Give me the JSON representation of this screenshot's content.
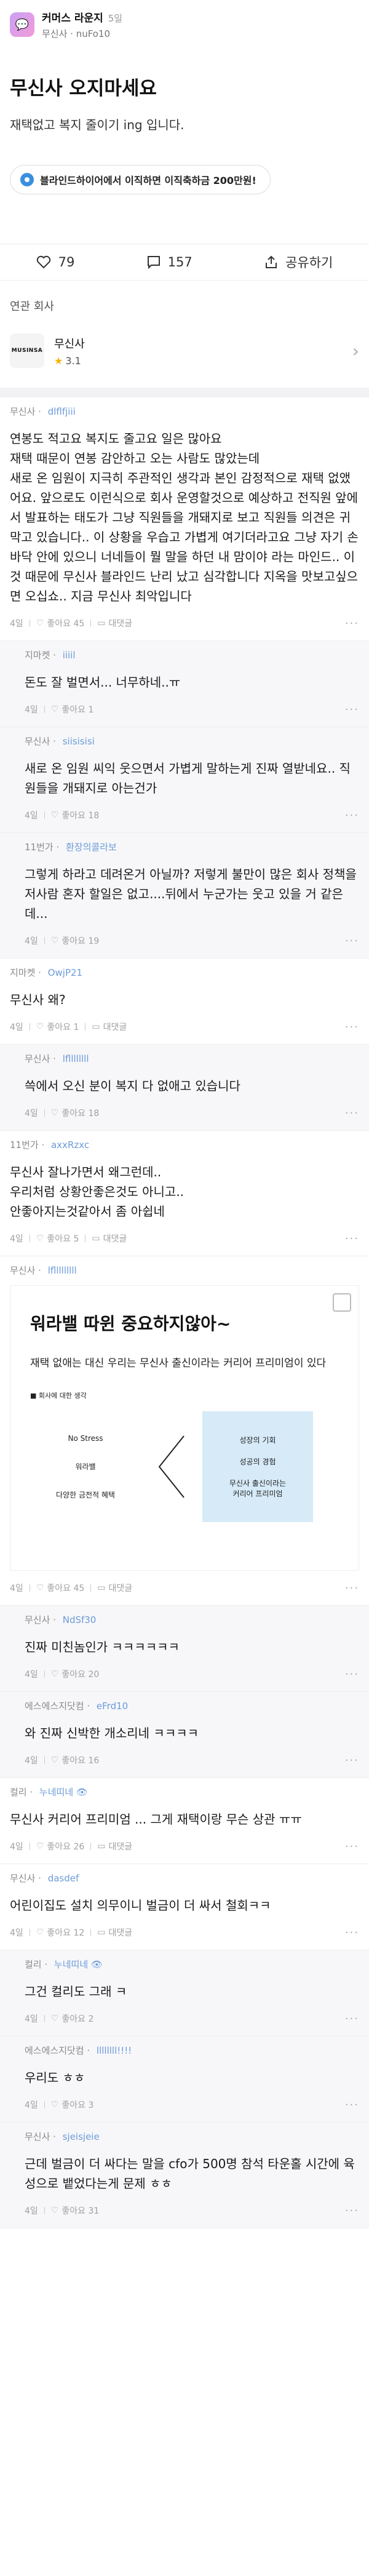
{
  "header": {
    "lounge_name": "커머스 라운지",
    "posted_ago": "5일",
    "author": "무신사 · nuFo10"
  },
  "post": {
    "title": "무신사 오지마세요",
    "body": "재택없고 복지 줄이기 ing 입니다."
  },
  "promo": {
    "label": "블라인드하이어에서 이직하면 이직축하금 200만원!"
  },
  "actions": {
    "likes": "79",
    "comments": "157",
    "share": "공유하기"
  },
  "related": {
    "section_title": "연관 회사",
    "company_name": "무신사",
    "rating": "3.1",
    "logo_text": "MUSINSA"
  },
  "labels": {
    "like": "좋아요",
    "reply": "대댓글"
  },
  "comments": [
    {
      "company": "무신사",
      "nick": "dlflfjiii",
      "text": "연봉도 적고요 복지도 줄고요 일은 많아요\n재택 때문이 연봉 감안하고 오는 사람도 많았는데\n새로 온 임원이 지극히 주관적인 생각과 본인 감정적으로 재택 없앴어요. 앞으로도 이런식으로 회사 운영할것으로 예상하고 전직원 앞에서 발표하는 태도가 그냥 직원들을 개돼지로 보고 직원들 의견은 귀막고 있습니다.. 이 상황을 우습고 가볍게 여기더라고요 그냥 자기 손바닥 안에 있으니 너네들이 뭘 말을 하던 내 맘이야 라는 마인드.. 이것 때문에 무신사 블라인드 난리 났고 심각합니다 지옥을 맛보고싶으면 오십쇼.. 지금 무신사 최악입니다",
      "date": "4일",
      "likes": "좋아요 45",
      "reply": true,
      "is_reply": false
    },
    {
      "company": "지마켓",
      "nick": "iiiil",
      "text": "돈도 잘 벌면서... 너무하네..ㅠ",
      "date": "4일",
      "likes": "좋아요 1",
      "reply": false,
      "is_reply": true
    },
    {
      "company": "무신사",
      "nick": "siisisisi",
      "text": "새로 온 임원 씨익 웃으면서 가볍게 말하는게 진짜 열받네요.. 직원들을 개돼지로 아는건가",
      "date": "4일",
      "likes": "좋아요 18",
      "reply": false,
      "is_reply": true
    },
    {
      "company": "11번가",
      "nick": "환장의콜라보",
      "text": "그렇게 하라고 데려온거 아닐까? 저렇게 불만이 많은 회사 정책을 저사람 혼자 할일은 없고....뒤에서 누군가는 웃고 있을 거 같은데...",
      "date": "4일",
      "likes": "좋아요 19",
      "reply": false,
      "is_reply": true
    },
    {
      "company": "지마켓",
      "nick": "OwjP21",
      "text": "무신사 왜?",
      "date": "4일",
      "likes": "좋아요 1",
      "reply": true,
      "is_reply": false
    },
    {
      "company": "무신사",
      "nick": "lfllllllll",
      "text": "쓱에서 오신 분이 복지 다 없애고 있습니다",
      "date": "4일",
      "likes": "좋아요 18",
      "reply": false,
      "is_reply": true
    },
    {
      "company": "11번가",
      "nick": "axxRzxc",
      "text": "무신사 잘나가면서 왜그런데..\n우리처럼 상황안좋은것도 아니고..\n안좋아지는것같아서 좀 아쉽네",
      "date": "4일",
      "likes": "좋아요 5",
      "reply": true,
      "is_reply": false
    },
    {
      "company": "무신사",
      "nick": "lflllllllll",
      "text": "",
      "date": "4일",
      "likes": "좋아요 45",
      "reply": true,
      "is_reply": false,
      "image": {
        "heading": "워라밸 따윈 중요하지않아~",
        "sub": "재택 없애는 대신 우리는 무신사 출신이라는 커리어 프리미엄이 있다",
        "label": "■ 회사에 대한 생각",
        "left": [
          "No Stress",
          "워라밸",
          "다양한 금전적 혜택"
        ],
        "right": [
          "성장의 기회",
          "성공의 경험",
          "무신사 출신이라는\n커리어 프리미엄"
        ]
      }
    },
    {
      "company": "무신사",
      "nick": "NdSf30",
      "text": "진짜 미친놈인가 ㅋㅋㅋㅋㅋㅋ",
      "date": "4일",
      "likes": "좋아요 20",
      "reply": false,
      "is_reply": true
    },
    {
      "company": "에스에스지닷컴",
      "nick": "eFrd10",
      "text": "와 진짜 신박한 개소리네 ㅋㅋㅋㅋ",
      "date": "4일",
      "likes": "좋아요 16",
      "reply": false,
      "is_reply": true
    },
    {
      "company": "컬리",
      "nick": "누네띠네 👁",
      "text": "무신사 커리어 프리미엄 ... 그게 재택이랑 무슨 상관 ㅠㅠ",
      "date": "4일",
      "likes": "좋아요 26",
      "reply": true,
      "is_reply": false
    },
    {
      "company": "무신사",
      "nick": "dasdef",
      "text": "어린이집도 설치 의무이니 벌금이 더 싸서 철회ㅋㅋ",
      "date": "4일",
      "likes": "좋아요 12",
      "reply": true,
      "is_reply": false
    },
    {
      "company": "컬리",
      "nick": "누네띠네 👁",
      "text": "그건 컬리도 그래 ㅋ",
      "date": "4일",
      "likes": "좋아요 2",
      "reply": false,
      "is_reply": true
    },
    {
      "company": "에스에스지닷컴",
      "nick": "llllllll!!!!",
      "text": "우리도 ㅎㅎ",
      "date": "4일",
      "likes": "좋아요 3",
      "reply": false,
      "is_reply": true
    },
    {
      "company": "무신사",
      "nick": "sjeisjeie",
      "text": "근데 벌금이 더 싸다는 말을 cfo가 500명 참석 타운홀 시간에 육성으로 뱉었다는게 문제 ㅎㅎ",
      "date": "4일",
      "likes": "좋아요 31",
      "reply": false,
      "is_reply": true
    }
  ]
}
